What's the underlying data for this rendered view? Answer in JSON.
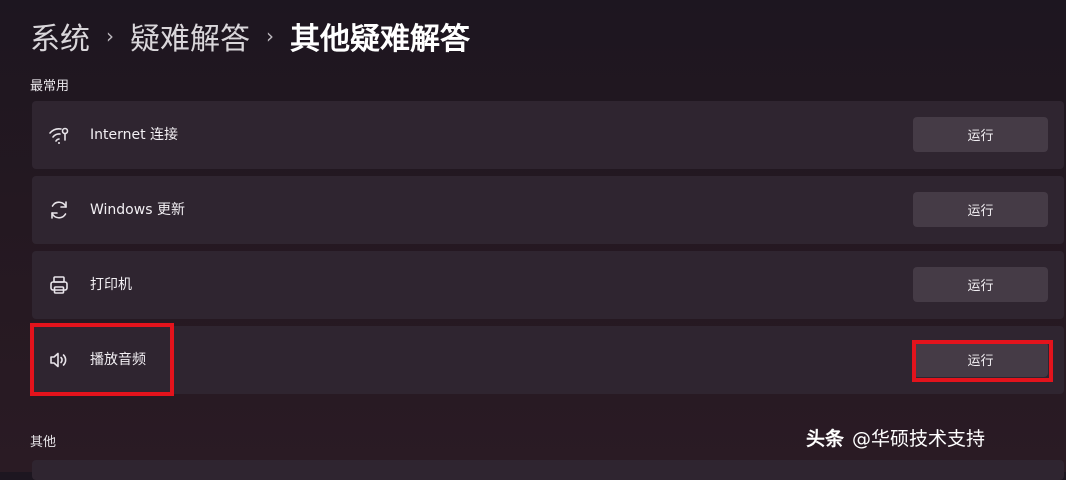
{
  "breadcrumb": {
    "items": [
      "系统",
      "疑难解答"
    ],
    "current": "其他疑难解答"
  },
  "sections": {
    "most_used": "最常用",
    "other": "其他"
  },
  "troubleshooters": [
    {
      "label": "Internet 连接",
      "icon": "wifi-icon",
      "action": "运行"
    },
    {
      "label": "Windows 更新",
      "icon": "refresh-icon",
      "action": "运行"
    },
    {
      "label": "打印机",
      "icon": "printer-icon",
      "action": "运行"
    },
    {
      "label": "播放音频",
      "icon": "speaker-icon",
      "action": "运行"
    }
  ],
  "watermark": {
    "brand": "头条",
    "handle": "@华硕技术支持"
  },
  "colors": {
    "highlight": "#e3131c",
    "card": "#2f2530",
    "button": "#453b46"
  }
}
